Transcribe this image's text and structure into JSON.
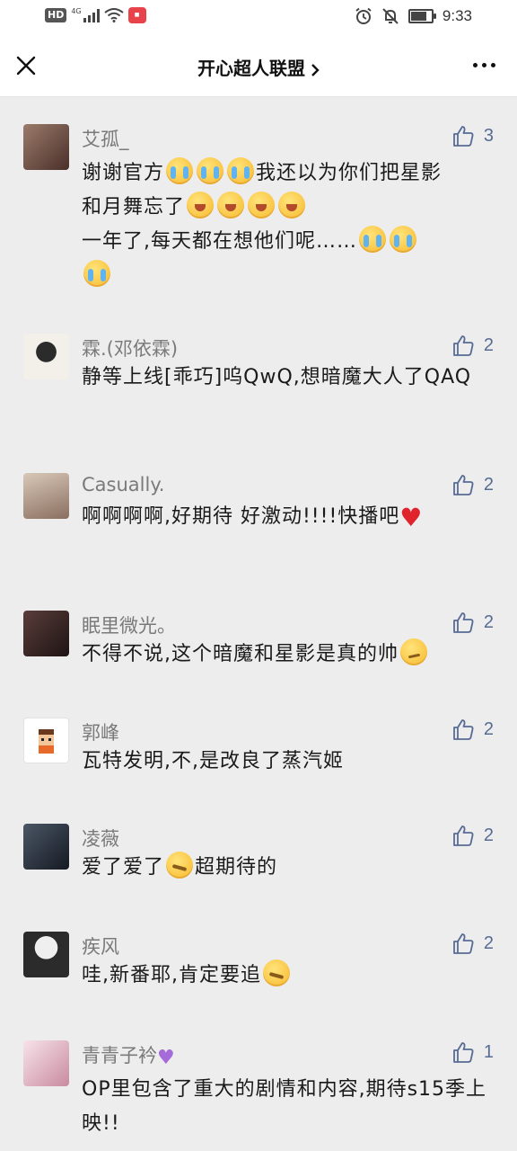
{
  "status_bar": {
    "hd": "HD",
    "network": "4G",
    "time": "9:33",
    "battery_level": 0.85
  },
  "header": {
    "title": "开心超人联盟",
    "close_icon": "close-icon",
    "more_icon": "more-icon"
  },
  "comments": [
    {
      "name": "艾孤_",
      "likes": "3",
      "lines": [
        "谢谢官方",
        "我还以为你们把星影",
        "和月舞忘了",
        "一年了,每天都在想他们呢……"
      ],
      "avatar_color": "#6b4a3a"
    },
    {
      "name": "霖.(邓依霖)",
      "likes": "2",
      "text": "静等上线[乖巧]呜QwQ,想暗魔大人了QAQ",
      "avatar_color": "#e8e2dc"
    },
    {
      "name": "Casually.",
      "likes": "2",
      "text": "啊啊啊啊,好期待 好激动!!!!快播吧",
      "avatar_color": "#c9b7a8"
    },
    {
      "name": "眠里微光。",
      "likes": "2",
      "text": "不得不说,这个暗魔和星影是真的帅",
      "avatar_color": "#3a2a2a"
    },
    {
      "name": "郭峰",
      "likes": "2",
      "text": "瓦特发明,不,是改良了蒸汽姬",
      "avatar_color": "#ffffff"
    },
    {
      "name": "凌薇",
      "likes": "2",
      "text": "爱了爱了",
      "text2": "超期待的",
      "avatar_color": "#2a3340"
    },
    {
      "name": "疾风",
      "likes": "2",
      "text": "哇,新番耶,肯定要追",
      "avatar_color": "#d9d9d9"
    },
    {
      "name": "青青子衿",
      "likes": "1",
      "text": "OP里包含了重大的剧情和内容,期待s15季上映!!",
      "avatar_color": "#f2dfe5"
    }
  ]
}
